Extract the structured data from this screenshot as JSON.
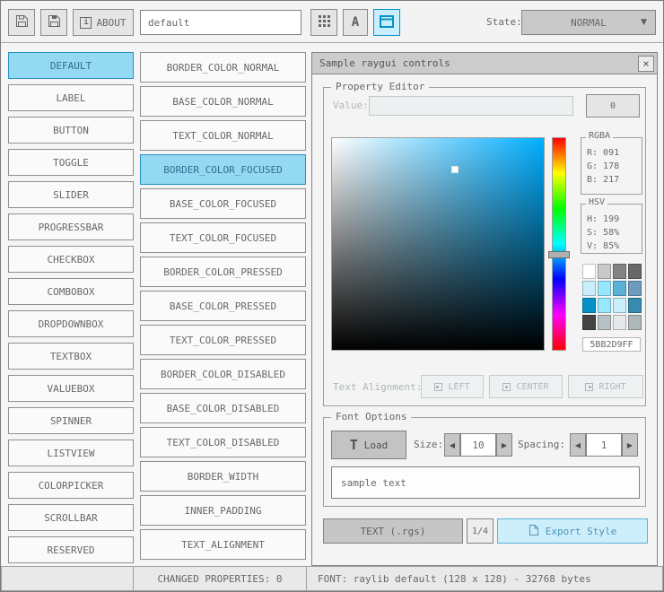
{
  "colors": {
    "selected_item_bg": "#93d9f2",
    "selected_item_border": "#2591c2",
    "selected_item_text": "#2f7191",
    "accent_active_bg": "#c9effe",
    "accent_active_border": "#0492c7",
    "export_button_bg": "#cdeefb",
    "export_button_border": "#5bb2d9",
    "export_button_text": "#4d93b8"
  },
  "toolbar": {
    "about_button": {
      "icon_glyph": "i",
      "label": "ABOUT"
    },
    "style_name_input": {
      "value": "default"
    },
    "font_button_label": "A",
    "state_label": "State:",
    "state_dropdown": {
      "value": "NORMAL",
      "arrow_icon": "▼"
    }
  },
  "controls": {
    "selected_index": 0,
    "items": [
      "DEFAULT",
      "LABEL",
      "BUTTON",
      "TOGGLE",
      "SLIDER",
      "PROGRESSBAR",
      "CHECKBOX",
      "COMBOBOX",
      "DROPDOWNBOX",
      "TEXTBOX",
      "VALUEBOX",
      "SPINNER",
      "LISTVIEW",
      "COLORPICKER",
      "SCROLLBAR",
      "RESERVED"
    ]
  },
  "properties": {
    "selected_index": 3,
    "items": [
      "BORDER_COLOR_NORMAL",
      "BASE_COLOR_NORMAL",
      "TEXT_COLOR_NORMAL",
      "BORDER_COLOR_FOCUSED",
      "BASE_COLOR_FOCUSED",
      "TEXT_COLOR_FOCUSED",
      "BORDER_COLOR_PRESSED",
      "BASE_COLOR_PRESSED",
      "TEXT_COLOR_PRESSED",
      "BORDER_COLOR_DISABLED",
      "BASE_COLOR_DISABLED",
      "TEXT_COLOR_DISABLED",
      "BORDER_WIDTH",
      "INNER_PADDING",
      "TEXT_ALIGNMENT"
    ]
  },
  "sample_window": {
    "title": "Sample raygui controls",
    "close_icon": "×",
    "property_editor": {
      "group_label": "Property Editor",
      "value_label": "Value:",
      "value_input": "",
      "value_button_label": "0",
      "picker": {
        "hue_deg": 199,
        "sat_pct": 58,
        "val_pct": 85
      },
      "rgba_group": {
        "label": "RGBA",
        "lines": [
          "R: 091",
          "G: 178",
          "B: 217"
        ]
      },
      "hsv_group": {
        "label": "HSV",
        "lines": [
          "H: 199",
          "S: 58%",
          "V: 85%"
        ]
      },
      "palette": [
        "#ffffff",
        "#c9c9c9",
        "#838383",
        "#686868",
        "#c9effe",
        "#97e8ff",
        "#5bb2d9",
        "#6c9bbc",
        "#0492c7",
        "#97e8ff",
        "#c9effe",
        "#368baf",
        "#444444",
        "#b5c1c2",
        "#e6e9e9",
        "#aeb7b8"
      ],
      "hex_value": "5BB2D9FF",
      "text_alignment_label": "Text Alignment:",
      "alignment_buttons": [
        "LEFT",
        "CENTER",
        "RIGHT"
      ]
    },
    "font_options": {
      "group_label": "Font Options",
      "load_button_icon": "T",
      "load_button_label": "Load",
      "size_label": "Size:",
      "size_value": "10",
      "spacing_label": "Spacing:",
      "spacing_value": "1",
      "spinner_left_icon": "◀",
      "spinner_right_icon": "▶",
      "sample_text": "sample text"
    },
    "export_bar": {
      "format_button_label": "TEXT (.rgs)",
      "pagination_label": "1/4",
      "export_button_label": "Export Style"
    }
  },
  "statusbar": {
    "changed_properties": "CHANGED PROPERTIES: 0",
    "font_info": "FONT: raylib default (128 x 128) - 32768 bytes"
  }
}
